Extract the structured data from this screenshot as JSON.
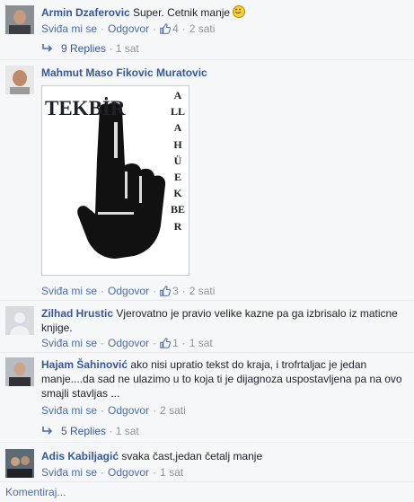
{
  "comments": [
    {
      "author": "Armin Dzaferovic",
      "text": "Super. Cetnik manje",
      "like_label": "Sviđa mi se",
      "reply_label": "Odgovor",
      "like_count": "4",
      "time": "2 sati",
      "replies_label": "9 Replies",
      "replies_time": "1 sat"
    },
    {
      "author": "Mahmut Maso Fikovic Muratovic",
      "text": "",
      "image": {
        "left_letters": "TEKBİR",
        "right_letters": "ALLAHÜEKBER"
      },
      "like_label": "Sviđa mi se",
      "reply_label": "Odgovor",
      "like_count": "3",
      "time": "2 sati"
    },
    {
      "author": "Zilhad Hrustic",
      "text": "Vjerovatno je pravio velike kazne pa ga izbrisalo iz maticne knjige.",
      "like_label": "Sviđa mi se",
      "reply_label": "Odgovor",
      "like_count": "1",
      "time": "1 sat"
    },
    {
      "author": "Hajam Šahinović",
      "text": "ako nisi upratio tekst do kraja, i trofrtaljac je jedan manje....da sad ne ulazimo u to koja ti je dijagnoza uspostavljena pa na ovo smajli stavljas ...",
      "like_label": "Sviđa mi se",
      "reply_label": "Odgovor",
      "time": "2 sati",
      "replies_label": "5 Replies",
      "replies_time": "1 sat"
    },
    {
      "author": "Adis Kabiljagić",
      "text": "svaka čast,jedan četalj manje",
      "like_label": "Sviđa mi se",
      "reply_label": "Odgovor",
      "time": "1 sat"
    }
  ],
  "compose_label": "Komentiraj...",
  "colors": {
    "link": "#365899",
    "meta": "#90949c",
    "background": "#f6f7f9"
  }
}
